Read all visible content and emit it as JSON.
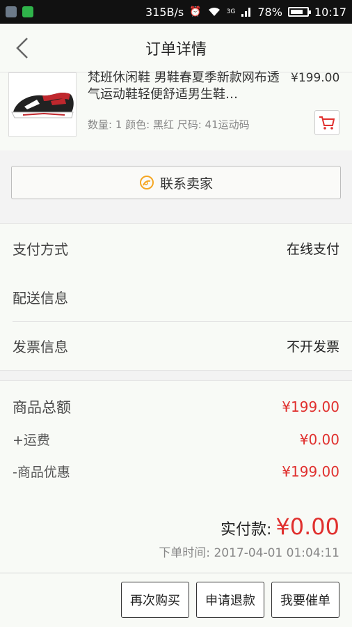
{
  "status_bar": {
    "net_speed": "315B/s",
    "network_type": "3G",
    "battery": "78%",
    "battery_level": 0.78,
    "time": "10:17",
    "icons": [
      "app-icon",
      "wechat-icon",
      "alarm-icon",
      "wifi-icon",
      "signal-icon",
      "battery-icon"
    ]
  },
  "header": {
    "title": "订单详情",
    "back_icon": "chevron-left-icon"
  },
  "product": {
    "name": "梵班休闲鞋 男鞋春夏季新款网布透气运动鞋轻便舒适男生鞋…",
    "price": "¥199.00",
    "specs": "数量: 1 颜色: 黑红 尺码: 41运动码",
    "cart_icon": "shopping-cart-icon"
  },
  "contact_seller": {
    "label": "联系卖家",
    "icon": "chat-bubble-icon",
    "accent": "#f5a623"
  },
  "info": {
    "payment_label": "支付方式",
    "payment_value": "在线支付",
    "delivery_label": "配送信息",
    "invoice_label": "发票信息",
    "invoice_value": "不开发票"
  },
  "totals": {
    "goods_label": "商品总额",
    "goods_value": "¥199.00",
    "shipping_label": "+运费",
    "shipping_value": "¥0.00",
    "discount_label": "-商品优惠",
    "discount_value": "¥199.00",
    "paid_label": "实付款:",
    "paid_value": "¥0.00",
    "order_time": "下单时间: 2017-04-01 01:04:11",
    "price_color": "#e0302e"
  },
  "actions": {
    "rebuy": "再次购买",
    "refund": "申请退款",
    "urge": "我要催单"
  }
}
